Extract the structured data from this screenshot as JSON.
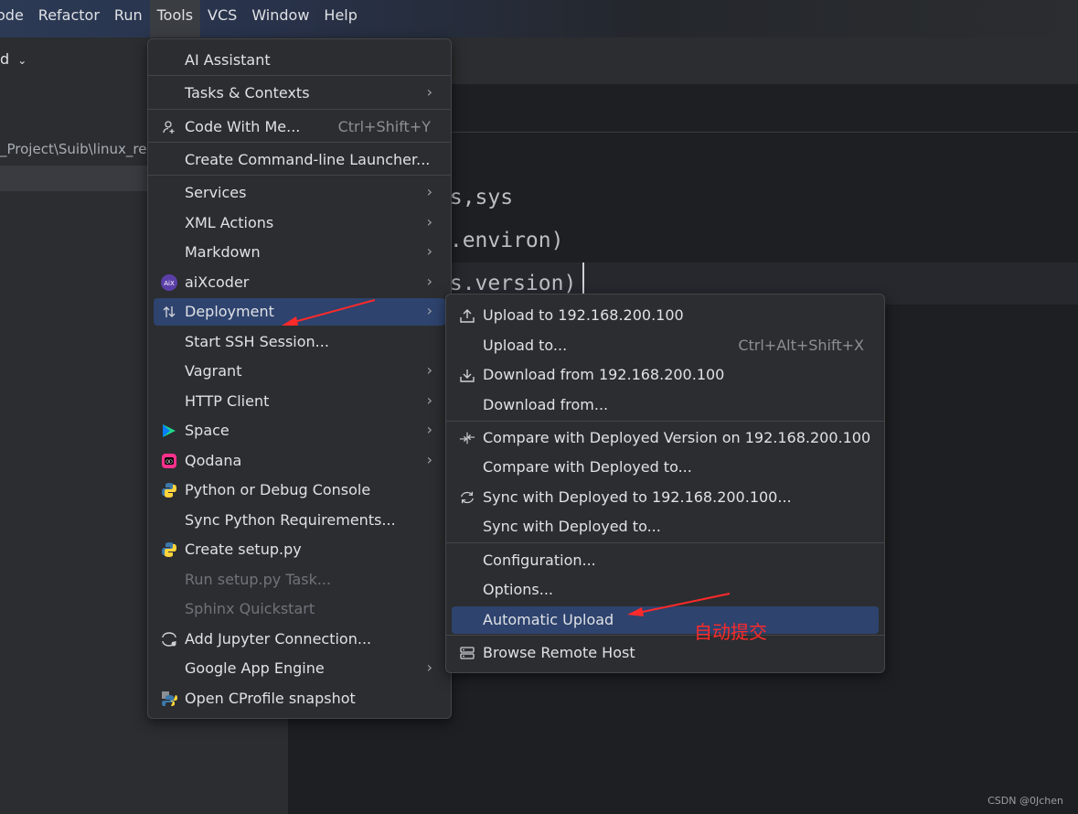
{
  "menubar": {
    "items": [
      "ode",
      "Refactor",
      "Run",
      "Tools",
      "VCS",
      "Window",
      "Help"
    ]
  },
  "toolbar": {
    "left_fragment": "d"
  },
  "project": {
    "path": "_Project\\Suib\\linux_re"
  },
  "editor": {
    "lines": [
      "ps,sys",
      "s.environ)",
      "ys.version)"
    ]
  },
  "tools_menu": [
    {
      "label": "AI Assistant"
    },
    {
      "label": "Tasks & Contexts",
      "submenu": true
    },
    {
      "label": "Code With Me...",
      "shortcut": "Ctrl+Shift+Y",
      "icon": "person-icon"
    },
    {
      "label": "Create Command-line Launcher..."
    },
    {
      "label": "Services",
      "submenu": true
    },
    {
      "label": "XML Actions",
      "submenu": true
    },
    {
      "label": "Markdown",
      "submenu": true
    },
    {
      "label": "aiXcoder",
      "submenu": true,
      "icon": "aixcoder-icon"
    },
    {
      "label": "Deployment",
      "submenu": true,
      "icon": "deployment-icon",
      "selected": true
    },
    {
      "label": "Start SSH Session..."
    },
    {
      "label": "Vagrant",
      "submenu": true
    },
    {
      "label": "HTTP Client",
      "submenu": true
    },
    {
      "label": "Space",
      "submenu": true,
      "icon": "space-icon"
    },
    {
      "label": "Qodana",
      "submenu": true,
      "icon": "qodana-icon"
    },
    {
      "label": "Python or Debug Console",
      "icon": "python-icon"
    },
    {
      "label": "Sync Python Requirements..."
    },
    {
      "label": "Create setup.py",
      "icon": "python-icon"
    },
    {
      "label": "Run setup.py Task...",
      "disabled": true
    },
    {
      "label": "Sphinx Quickstart",
      "disabled": true
    },
    {
      "label": "Add Jupyter Connection...",
      "icon": "jupyter-icon"
    },
    {
      "label": "Google App Engine",
      "submenu": true
    },
    {
      "label": "Open CProfile snapshot",
      "icon": "cprofile-icon"
    }
  ],
  "deployment_menu": [
    {
      "label": "Upload to 192.168.200.100",
      "icon": "upload-icon"
    },
    {
      "label": "Upload to...",
      "shortcut": "Ctrl+Alt+Shift+X"
    },
    {
      "label": "Download from 192.168.200.100",
      "icon": "download-icon"
    },
    {
      "label": "Download from..."
    },
    {
      "label": "Compare with Deployed Version on 192.168.200.100",
      "icon": "compare-icon"
    },
    {
      "label": "Compare with Deployed to..."
    },
    {
      "label": "Sync with Deployed to 192.168.200.100...",
      "icon": "sync-icon"
    },
    {
      "label": "Sync with Deployed to..."
    },
    {
      "label": "Configuration..."
    },
    {
      "label": "Options..."
    },
    {
      "label": "Automatic Upload",
      "selected": true
    },
    {
      "label": "Browse Remote Host",
      "icon": "server-icon"
    }
  ],
  "annotation": {
    "text": "自动提交",
    "color": "#ff2a2a"
  },
  "watermark": "CSDN @0Jchen",
  "colors": {
    "selection": "#2e436e",
    "menu_bg": "#2b2d30",
    "annotation": "#ff2a2a"
  }
}
